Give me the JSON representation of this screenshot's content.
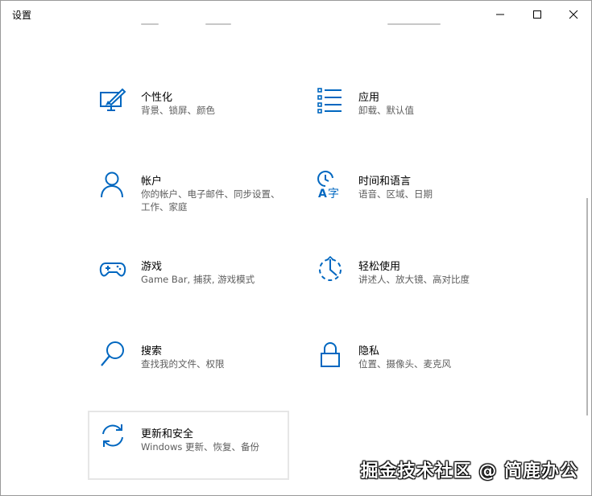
{
  "window": {
    "title": "设置"
  },
  "colors": {
    "accent": "#0067c0",
    "text_secondary": "#5d5d5d"
  },
  "tiles": [
    {
      "name": "个性化",
      "desc": "背景、锁屏、颜色",
      "icon": "personalization-icon"
    },
    {
      "name": "应用",
      "desc": "卸载、默认值",
      "icon": "apps-icon"
    },
    {
      "name": "帐户",
      "desc": "你的帐户、电子邮件、同步设置、工作、家庭",
      "icon": "account-icon"
    },
    {
      "name": "时间和语言",
      "desc": "语音、区域、日期",
      "icon": "time-language-icon"
    },
    {
      "name": "游戏",
      "desc": "Game Bar, 捕获, 游戏模式",
      "icon": "gaming-icon"
    },
    {
      "name": "轻松使用",
      "desc": "讲述人、放大镜、高对比度",
      "icon": "ease-of-access-icon"
    },
    {
      "name": "搜索",
      "desc": "查找我的文件、权限",
      "icon": "search-icon"
    },
    {
      "name": "隐私",
      "desc": "位置、摄像头、麦克风",
      "icon": "privacy-lock-icon"
    },
    {
      "name": "更新和安全",
      "desc": "Windows 更新、恢复、备份",
      "icon": "update-sync-icon"
    }
  ],
  "watermark": "掘金技术社区 @ 简鹿办公"
}
